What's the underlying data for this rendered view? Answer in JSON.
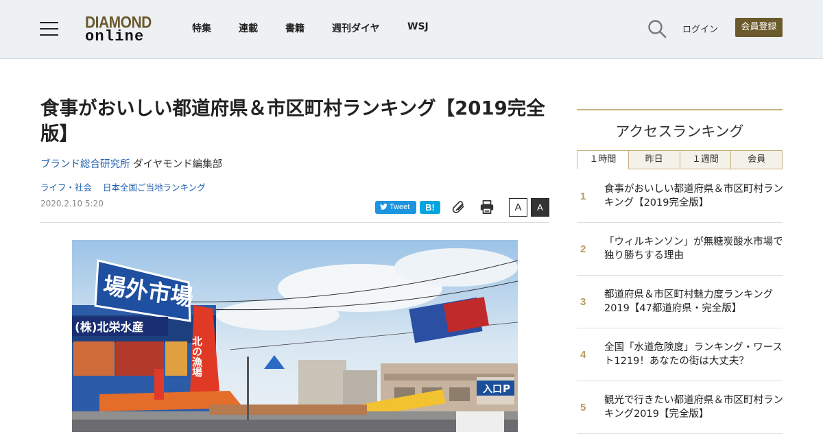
{
  "header": {
    "logo_top": "DIAMOND",
    "logo_bottom": "online",
    "nav": [
      "特集",
      "連載",
      "書籍",
      "週刊ダイヤ",
      "WSJ"
    ],
    "login": "ログイン",
    "register": "会員登録"
  },
  "article": {
    "title": "食事がおいしい都道府県＆市区町村ランキング【2019完全版】",
    "author_org": "ブランド総合研究所",
    "author_person": "ダイヤモンド編集部",
    "categories": [
      "ライフ・社会",
      "日本全国ご当地ランキング"
    ],
    "date": "2020.2.10 5:20",
    "share": {
      "tweet": "Tweet",
      "hatena": "B!"
    },
    "font_small": "A",
    "font_large": "A",
    "photo_signs": {
      "main": "場外市場",
      "shop": "(株)北栄水産",
      "banner": "北の漁場",
      "entrance": "入口",
      "parking": "P"
    }
  },
  "ranking": {
    "title": "アクセスランキング",
    "tabs": [
      "１時間",
      "昨日",
      "１週間",
      "会員"
    ],
    "active_tab": 0,
    "items": [
      {
        "rank": "1",
        "text": "食事がおいしい都道府県＆市区町村ランキング【2019完全版】"
      },
      {
        "rank": "2",
        "text": "「ウィルキンソン」が無糖炭酸水市場で独り勝ちする理由"
      },
      {
        "rank": "3",
        "text": "都道府県＆市区町村魅力度ランキング2019【47都道府県・完全版】"
      },
      {
        "rank": "4",
        "text": "全国「水道危険度」ランキング・ワースト1219！あなたの街は大丈夫？"
      },
      {
        "rank": "5",
        "text": "観光で行きたい都道府県＆市区町村ランキング2019【完全版】"
      }
    ]
  },
  "colors": {
    "accent_gold": "#c4b17e",
    "register_bg": "#6b5a2c",
    "link_blue": "#1f5fb0",
    "tweet_blue": "#1b95e0",
    "hatena_blue": "#00a4de"
  }
}
